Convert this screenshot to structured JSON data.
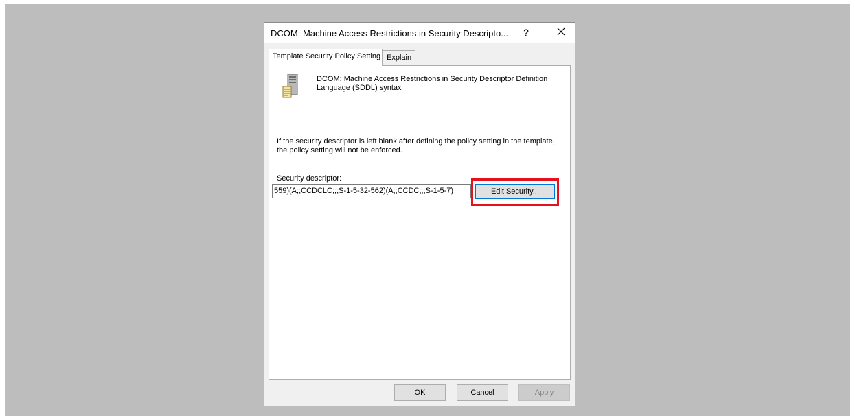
{
  "dialog": {
    "title": "DCOM: Machine Access Restrictions in Security Descripto...",
    "help_glyph": "?",
    "close_glyph": "✕"
  },
  "tabs": [
    {
      "label": "Template Security Policy Setting",
      "active": true
    },
    {
      "label": "Explain",
      "active": false
    }
  ],
  "panel": {
    "icon": "server-policy-icon",
    "heading": "DCOM: Machine Access Restrictions in Security Descriptor Definition Language (SDDL) syntax",
    "info": "If the security descriptor is left blank after defining the policy setting in the template, the policy setting will not be enforced.",
    "security_descriptor_label": "Security descriptor:",
    "security_descriptor_value": "559)(A;;CCDCLC;;;S-1-5-32-562)(A;;CCDC;;;S-1-5-7)",
    "edit_security_label": "Edit Security..."
  },
  "footer": {
    "ok_label": "OK",
    "cancel_label": "Cancel",
    "apply_label": "Apply"
  },
  "colors": {
    "highlight": "#e8101c",
    "focus_border": "#0078d7",
    "backdrop": "#bdbdbd"
  }
}
